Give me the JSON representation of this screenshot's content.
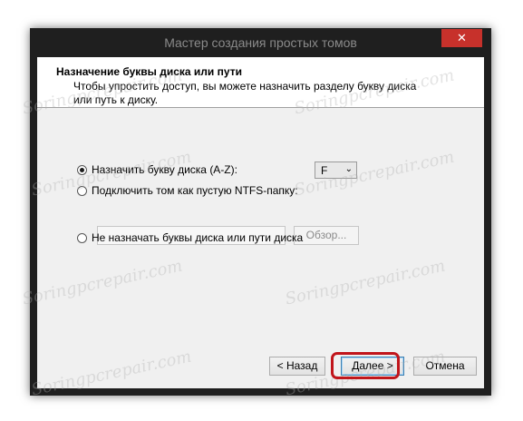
{
  "window": {
    "title": "Мастер создания простых томов",
    "close_symbol": "✕"
  },
  "header": {
    "title": "Назначение буквы диска или пути",
    "description": "Чтобы упростить доступ, вы можете назначить разделу букву диска или путь к диску."
  },
  "options": {
    "assign_letter": {
      "label": "Назначить букву диска (A-Z):",
      "selected": true
    },
    "mount_folder": {
      "label": "Подключить том как пустую NTFS-папку:",
      "selected": false
    },
    "no_letter": {
      "label": "Не назначать буквы диска или пути диска",
      "selected": false
    }
  },
  "drive_letter": {
    "value": "F",
    "arrow": "⌄"
  },
  "browse_label": "Обзор...",
  "footer": {
    "back_label": "< Назад",
    "next_label": "Далее >",
    "cancel_label": "Отмена"
  },
  "watermark": "Soringpcrepair.com",
  "colors": {
    "frame": "#1f1f1f",
    "close": "#c7312b",
    "highlight": "#c1151b"
  }
}
